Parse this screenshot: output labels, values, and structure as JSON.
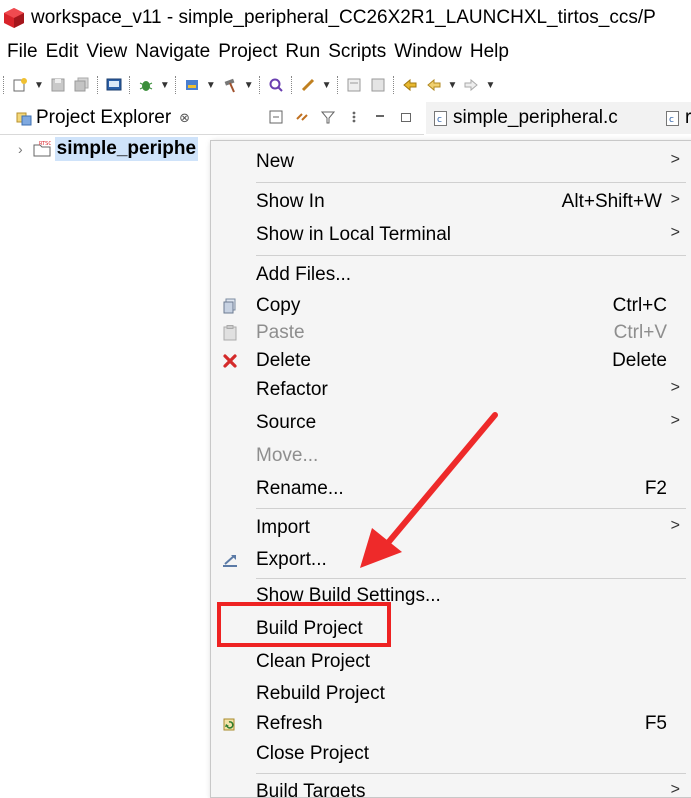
{
  "window": {
    "title": "workspace_v11 - simple_peripheral_CC26X2R1_LAUNCHXL_tirtos_ccs/P"
  },
  "menubar": [
    "File",
    "Edit",
    "View",
    "Navigate",
    "Project",
    "Run",
    "Scripts",
    "Window",
    "Help"
  ],
  "project_explorer": {
    "tab_label": "Project Explorer",
    "close_glyph": "⊗",
    "tree_item": "simple_periphe"
  },
  "editor": {
    "tabs": [
      "simple_peripheral.c",
      "r"
    ]
  },
  "context_menu": {
    "items": [
      {
        "label": "New",
        "shortcut": "",
        "submenu": true,
        "icon": "",
        "disabled": false
      },
      {
        "label": "Show In",
        "shortcut": "Alt+Shift+W",
        "submenu": true,
        "icon": "",
        "disabled": false
      },
      {
        "label": "Show in Local Terminal",
        "shortcut": "",
        "submenu": true,
        "icon": "",
        "disabled": false
      },
      {
        "label": "Add Files...",
        "shortcut": "",
        "submenu": false,
        "icon": "",
        "disabled": false
      },
      {
        "label": "Copy",
        "shortcut": "Ctrl+C",
        "submenu": false,
        "icon": "copy-icon",
        "disabled": false
      },
      {
        "label": "Paste",
        "shortcut": "Ctrl+V",
        "submenu": false,
        "icon": "paste-icon",
        "disabled": true
      },
      {
        "label": "Delete",
        "shortcut": "Delete",
        "submenu": false,
        "icon": "delete-icon",
        "disabled": false
      },
      {
        "label": "Refactor",
        "shortcut": "",
        "submenu": true,
        "icon": "",
        "disabled": false
      },
      {
        "label": "Source",
        "shortcut": "",
        "submenu": true,
        "icon": "",
        "disabled": false
      },
      {
        "label": "Move...",
        "shortcut": "",
        "submenu": false,
        "icon": "",
        "disabled": true
      },
      {
        "label": "Rename...",
        "shortcut": "F2",
        "submenu": false,
        "icon": "",
        "disabled": false
      },
      {
        "label": "Import",
        "shortcut": "",
        "submenu": true,
        "icon": "",
        "disabled": false
      },
      {
        "label": "Export...",
        "shortcut": "",
        "submenu": false,
        "icon": "export-icon",
        "disabled": false
      },
      {
        "label": "Show Build Settings...",
        "shortcut": "",
        "submenu": false,
        "icon": "",
        "disabled": false
      },
      {
        "label": "Build Project",
        "shortcut": "",
        "submenu": false,
        "icon": "",
        "disabled": false
      },
      {
        "label": "Clean Project",
        "shortcut": "",
        "submenu": false,
        "icon": "",
        "disabled": false
      },
      {
        "label": "Rebuild Project",
        "shortcut": "",
        "submenu": false,
        "icon": "",
        "disabled": false
      },
      {
        "label": "Refresh",
        "shortcut": "F5",
        "submenu": false,
        "icon": "refresh-icon",
        "disabled": false
      },
      {
        "label": "Close Project",
        "shortcut": "",
        "submenu": false,
        "icon": "",
        "disabled": false
      },
      {
        "label": "Build Targets",
        "shortcut": "",
        "submenu": true,
        "icon": "",
        "disabled": false
      }
    ],
    "submenu_glyph": ">"
  },
  "annotation": {
    "highlight_color": "#ee2222",
    "target_item": "Build Project"
  }
}
